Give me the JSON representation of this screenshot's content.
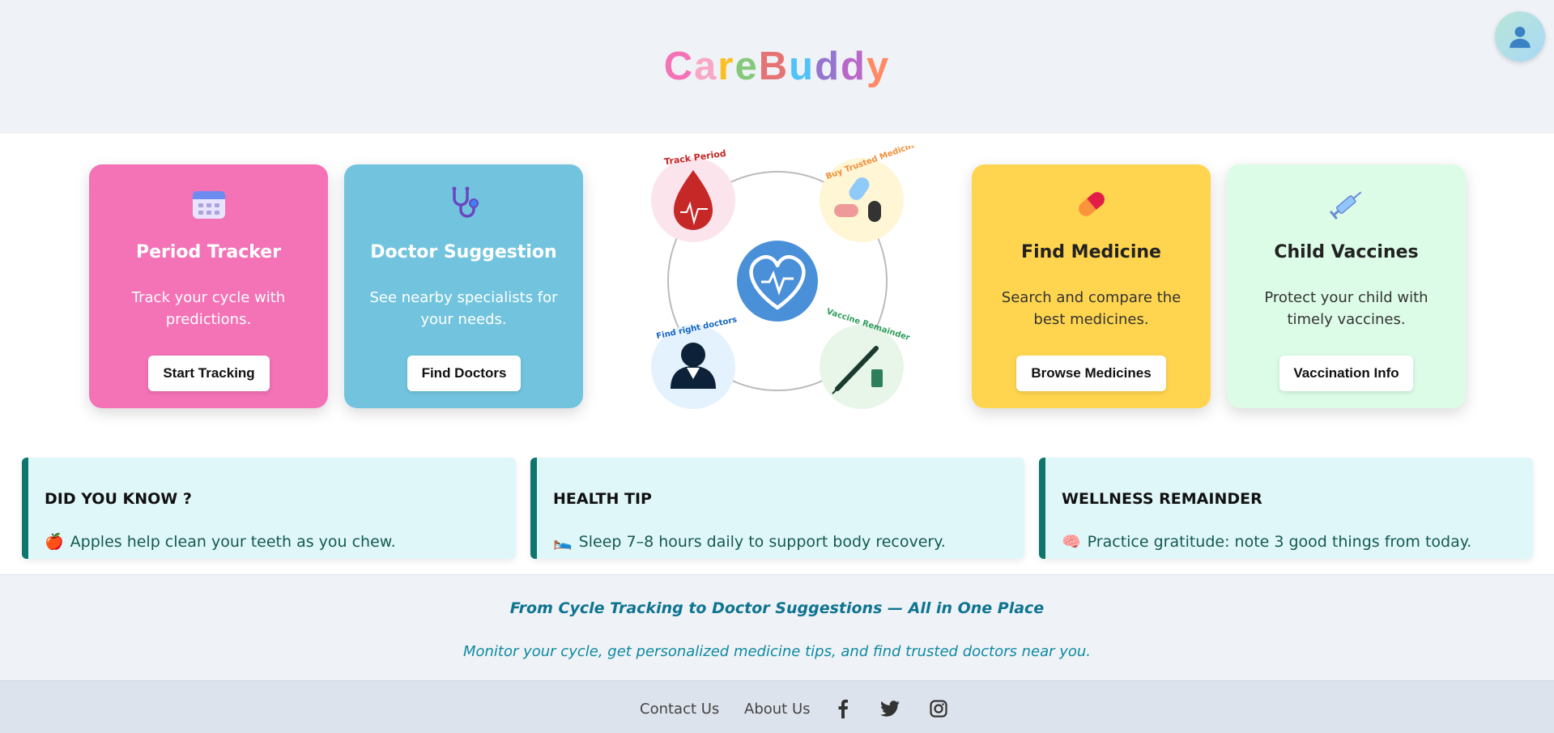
{
  "header": {
    "logo_letters": [
      {
        "ch": "C",
        "color": "#f472b6"
      },
      {
        "ch": "a",
        "color": "#f9a8c4"
      },
      {
        "ch": "r",
        "color": "#fbbf24"
      },
      {
        "ch": "e",
        "color": "#86c87a"
      },
      {
        "ch": "B",
        "color": "#e57373"
      },
      {
        "ch": "u",
        "color": "#4fc3f7"
      },
      {
        "ch": "d",
        "color": "#9575cd"
      },
      {
        "ch": "d",
        "color": "#ba68c8"
      },
      {
        "ch": "y",
        "color": "#ff8a65"
      }
    ],
    "avatar_icon": "user-icon"
  },
  "cards": [
    {
      "title": "Period Tracker",
      "description": "Track your cycle with predictions.",
      "button": "Start Tracking",
      "icon": "calendar-icon",
      "color": "#f472b6"
    },
    {
      "title": "Doctor Suggestion",
      "description": "See nearby specialists for your needs.",
      "button": "Find Doctors",
      "icon": "stethoscope-icon",
      "color": "#72c4de"
    },
    {
      "title": "Find Medicine",
      "description": "Search and compare the best medicines.",
      "button": "Browse Medicines",
      "icon": "pill-icon",
      "color": "#ffd54f"
    },
    {
      "title": "Child Vaccines",
      "description": "Protect your child with timely vaccines.",
      "button": "Vaccination Info",
      "icon": "syringe-icon",
      "color": "#dcfce7"
    }
  ],
  "diagram": {
    "labels": {
      "track_period": "Track Period",
      "buy_medicines": "Buy Trusted Medicines",
      "find_doctors": "Find right doctors",
      "vaccine": "Vaccine Remainder"
    }
  },
  "tips": [
    {
      "heading": "DID YOU KNOW ?",
      "emoji": "🍎",
      "text": "Apples help clean your teeth as you chew."
    },
    {
      "heading": "HEALTH TIP",
      "emoji": "🛌",
      "text": "Sleep 7–8 hours daily to support body recovery."
    },
    {
      "heading": "WELLNESS REMAINDER",
      "emoji": "🧠",
      "text": "Practice gratitude: note 3 good things from today."
    }
  ],
  "tagline": {
    "headline": "From Cycle Tracking to Doctor Suggestions — All in One Place",
    "subline": "Monitor your cycle, get personalized medicine tips, and find trusted doctors near you."
  },
  "footer": {
    "contact": "Contact Us",
    "about": "About Us",
    "social": [
      "facebook-icon",
      "twitter-icon",
      "instagram-icon"
    ]
  }
}
